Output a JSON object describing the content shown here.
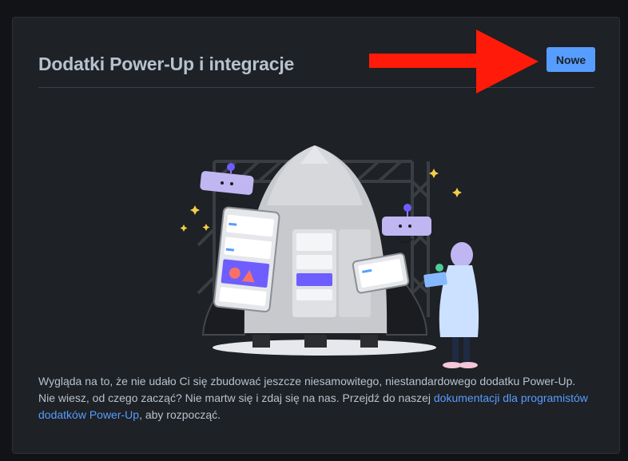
{
  "panel": {
    "title": "Dodatki Power-Up i integracje",
    "new_button_label": "Nowe"
  },
  "description": {
    "text_before": "Wygląda na to, że nie udało Ci się zbudować jeszcze niesamowitego, niestandardowego dodatku Power-Up. Nie wiesz, od czego zacząć? Nie martw się i zdaj się na nas. Przejdź do naszej ",
    "link_text": "dokumentacji dla programistów dodatków Power-Up",
    "text_after": ", aby rozpocząć."
  },
  "icons": {
    "annotation": "red-arrow-icon",
    "illustration": "rocket-robots-illustration"
  },
  "colors": {
    "background": "#1e2125",
    "button": "#579dff",
    "link": "#579dff",
    "arrow": "#ff1a0a"
  }
}
